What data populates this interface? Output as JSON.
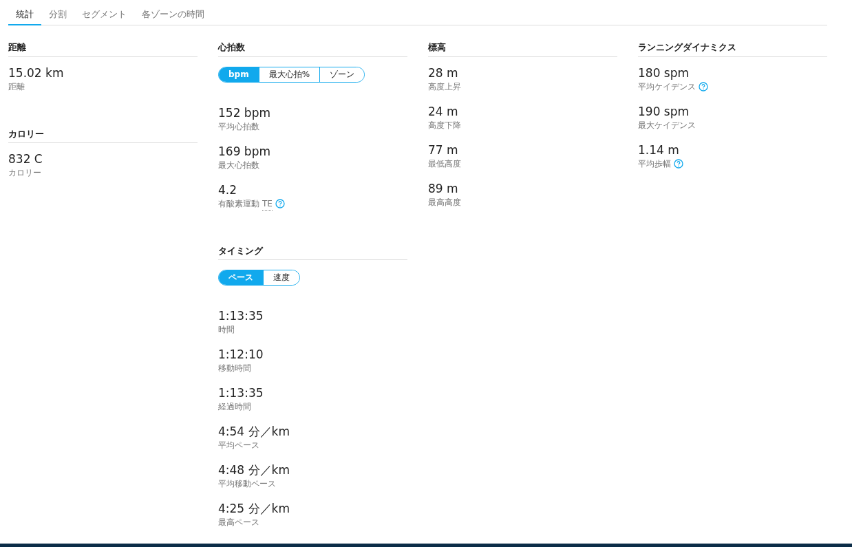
{
  "tabs": [
    {
      "label": "統計",
      "selected": true
    },
    {
      "label": "分割",
      "selected": false
    },
    {
      "label": "セグメント",
      "selected": false
    },
    {
      "label": "各ゾーンの時間",
      "selected": false
    }
  ],
  "columns": [
    {
      "sections": [
        {
          "title": "距離",
          "stats": [
            {
              "value": "15.02 km",
              "label": "距離"
            }
          ]
        },
        {
          "title": "カロリー",
          "stats": [
            {
              "value": "832 C",
              "label": "カロリー"
            }
          ]
        }
      ]
    },
    {
      "sections": [
        {
          "title": "心拍数",
          "toggle": [
            {
              "label": "bpm",
              "selected": true
            },
            {
              "label": "最大心拍%",
              "selected": false
            },
            {
              "label": "ゾーン",
              "selected": false
            }
          ],
          "stats": [
            {
              "value": "152 bpm",
              "label": "平均心拍数"
            },
            {
              "value": "169 bpm",
              "label": "最大心拍数"
            },
            {
              "value": "4.2",
              "label": "有酸素運動",
              "abbr": "TE",
              "help": true
            }
          ]
        },
        {
          "title": "タイミング",
          "toggle": [
            {
              "label": "ペース",
              "selected": true
            },
            {
              "label": "速度",
              "selected": false
            }
          ],
          "stats": [
            {
              "value": "1:13:35",
              "label": "時間"
            },
            {
              "value": "1:12:10",
              "label": "移動時間"
            },
            {
              "value": "1:13:35",
              "label": "経過時間"
            },
            {
              "value": "4:54 分／km",
              "label": "平均ペース"
            },
            {
              "value": "4:48 分／km",
              "label": "平均移動ペース"
            },
            {
              "value": "4:25 分／km",
              "label": "最高ペース"
            }
          ]
        }
      ]
    },
    {
      "sections": [
        {
          "title": "標高",
          "stats": [
            {
              "value": "28 m",
              "label": "高度上昇"
            },
            {
              "value": "24 m",
              "label": "高度下降"
            },
            {
              "value": "77 m",
              "label": "最低高度"
            },
            {
              "value": "89 m",
              "label": "最高高度"
            }
          ]
        }
      ]
    },
    {
      "sections": [
        {
          "title": "ランニングダイナミクス",
          "stats": [
            {
              "value": "180 spm",
              "label": "平均ケイデンス",
              "help": true
            },
            {
              "value": "190 spm",
              "label": "最大ケイデンス"
            },
            {
              "value": "1.14 m",
              "label": "平均歩幅",
              "help": true
            }
          ]
        }
      ]
    }
  ]
}
